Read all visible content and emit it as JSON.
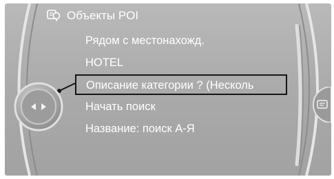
{
  "header": {
    "title": "Объекты POI",
    "icon": "poi-map-icon"
  },
  "menu": {
    "items": [
      {
        "label": "Рядом с местонахожд.",
        "selected": false
      },
      {
        "label": "HOTEL",
        "selected": false
      },
      {
        "label": "Описание категории ? (Несколь",
        "selected": true
      },
      {
        "label": "Начать поиск",
        "selected": false
      },
      {
        "label": "Название: поиск А-Я",
        "selected": false
      }
    ]
  },
  "controller": {
    "icon": "controller-knob-icon"
  },
  "side_button": {
    "icon": "side-options-icon"
  },
  "colors": {
    "screen_background": "#b0b0b0",
    "text": "#ffffff",
    "selection_border": "#151515"
  }
}
